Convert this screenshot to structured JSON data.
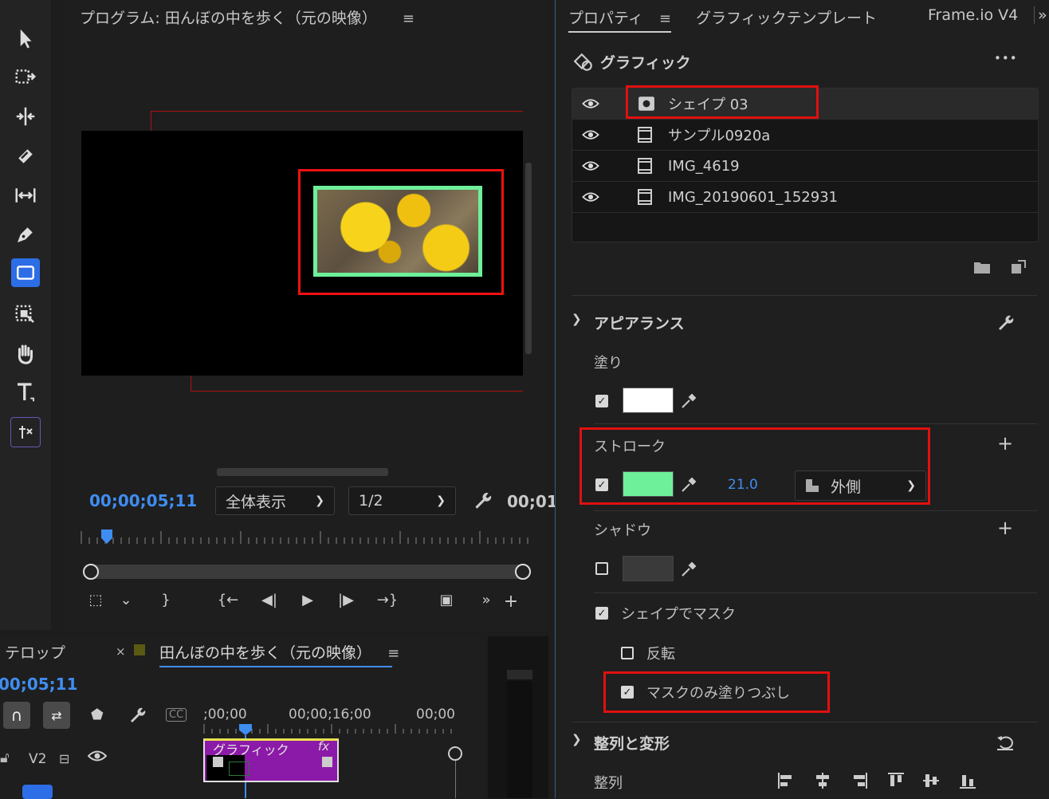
{
  "program_monitor": {
    "title": "プログラム: 田んぼの中を歩く（元の映像）",
    "timecode": "00;00;05;11",
    "zoom_select": "全体表示",
    "resolution_select": "1/2",
    "end_timecode": "00;01"
  },
  "tools": [
    "selection-tool",
    "track-select-tool",
    "ripple-edit-tool",
    "razor-tool",
    "slip-tool",
    "pen-tool",
    "rectangle-tool",
    "rate-stretch-tool",
    "hand-tool",
    "type-tool",
    "generative-extend-tool"
  ],
  "timeline": {
    "tab_captions": "テロップ",
    "tab_close": "×",
    "tab_sequence": "田んぼの中を歩く（元の映像）",
    "timecode": "00;05;11",
    "ruler_ticks": [
      ";00;00",
      "00;00;16;00",
      "00;00"
    ],
    "track_label": "V2",
    "clip_label": "グラフィック",
    "clip_fx": "fx"
  },
  "properties": {
    "tabs": [
      "プロパティ",
      "グラフィックテンプレート",
      "Frame.io V4"
    ],
    "more_tabs": "»",
    "graphic_header": "グラフィック",
    "more_menu": "•••",
    "layers": [
      {
        "name": "シェイプ 03",
        "type": "shape"
      },
      {
        "name": "サンプル0920a",
        "type": "clip"
      },
      {
        "name": "IMG_4619",
        "type": "clip"
      },
      {
        "name": "IMG_20190601_152931",
        "type": "clip"
      }
    ],
    "appearance": {
      "title": "アピアランス",
      "fill_label": "塗り",
      "fill_color": "#ffffff",
      "fill_checked": true,
      "stroke_label": "ストローク",
      "stroke_color": "#6ef09a",
      "stroke_checked": true,
      "stroke_width": "21.0",
      "stroke_position": "外側",
      "shadow_label": "シャドウ",
      "shadow_checked": false,
      "mask_with_shape": "シェイプでマスク",
      "mask_checked": true,
      "invert": "反転",
      "invert_checked": false,
      "mask_fill_only": "マスクのみ塗りつぶし",
      "mask_fill_checked": true
    },
    "align_transform": {
      "title": "整列と変形",
      "align_label": "整列"
    }
  },
  "colors": {
    "accent_blue": "#3f8df0",
    "highlight_red": "#e01010",
    "clip_purple": "#8b1aa8"
  }
}
